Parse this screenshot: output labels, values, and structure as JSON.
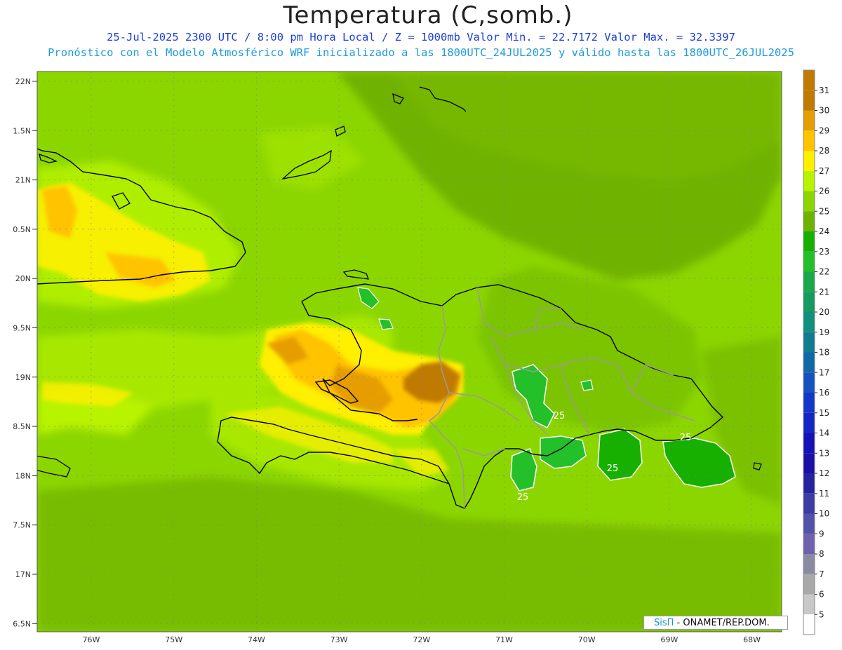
{
  "header": {
    "title": "Temperatura (C,somb.)",
    "line1": "25-Jul-2025  2300 UTC / 8:00 pm Hora Local / Z = 1000mb   Valor Min. = 22.7172  Valor Max. = 32.3397",
    "line2": "Pronóstico con el Modelo Atmosférico WRF inicializado a las 1800UTC_24JUL2025 y válido hasta las  1800UTC_26JUL2025"
  },
  "map": {
    "lon_ticks": [
      "76W",
      "75W",
      "74W",
      "73W",
      "72W",
      "71W",
      "70W",
      "69W",
      "68W"
    ],
    "lat_ticks": [
      "22N",
      "1.5N",
      "21N",
      "0.5N",
      "20N",
      "9.5N",
      "19N",
      "8.5N",
      "18N",
      "7.5N",
      "17N",
      "6.5N"
    ],
    "contour_labels": [
      "25",
      "25",
      "25",
      "25",
      "25"
    ],
    "value_min": 22.7172,
    "value_max": 32.3397
  },
  "colorbar": {
    "labels": [
      "31",
      "30",
      "29",
      "28",
      "27",
      "26",
      "25",
      "24",
      "23",
      "22",
      "21",
      "20",
      "19",
      "18",
      "17",
      "16",
      "15",
      "14",
      "13",
      "12",
      "11",
      "10",
      "9",
      "8",
      "7",
      "6",
      "5"
    ],
    "colors": [
      "#c07a00",
      "#e69d00",
      "#ffc300",
      "#ffef00",
      "#b8f300",
      "#8cd600",
      "#6fb200",
      "#17b000",
      "#24c02a",
      "#1aa84a",
      "#159a60",
      "#138f7e",
      "#117c90",
      "#1168a8",
      "#1452c0",
      "#1238c8",
      "#1526c4",
      "#1412b8",
      "#1a10a8",
      "#2424a0",
      "#3c3ca4",
      "#5252aa",
      "#6f60ae",
      "#8a8aa0",
      "#a8a8a8",
      "#c8c8c8",
      "#ffffff"
    ]
  },
  "credit": {
    "brand": "SisΠ",
    "text": " - ONAMET/REP.DOM."
  }
}
